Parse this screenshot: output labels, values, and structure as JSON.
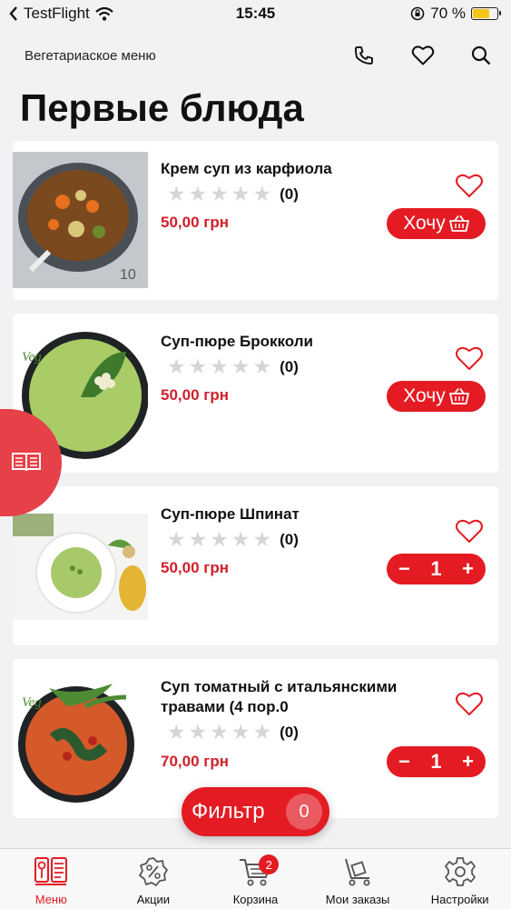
{
  "status": {
    "carrier": "TestFlight",
    "time": "15:45",
    "battery": "70 %",
    "battery_level": 0.7
  },
  "header": {
    "title": "Вегетариаское меню",
    "icons": [
      "phone-icon",
      "heart-icon",
      "search-icon"
    ]
  },
  "page_title": "Первые блюда",
  "products": [
    {
      "name": "Крем суп из карфиола",
      "rating": "(0)",
      "price": "50,00 грн",
      "action": "want",
      "want_label": "Хочу"
    },
    {
      "name": "Суп-пюре Брокколи",
      "rating": "(0)",
      "price": "50,00 грн",
      "action": "want",
      "want_label": "Хочу"
    },
    {
      "name": "Суп-пюре Шпинат",
      "rating": "(0)",
      "price": "50,00 грн",
      "action": "stepper",
      "minus": "−",
      "quantity": "1",
      "plus": "+"
    },
    {
      "name": "Суп томатный с итальянскими травами (4 пор.0",
      "rating": "(0)",
      "price": "70,00 грн",
      "action": "stepper",
      "minus": "−",
      "quantity": "1",
      "plus": "+"
    }
  ],
  "filter": {
    "label": "Фильтр",
    "count": "0"
  },
  "tabbar": {
    "items": [
      {
        "label": "Меню",
        "icon": "menu-book-icon",
        "active": true
      },
      {
        "label": "Акции",
        "icon": "percent-badge-icon"
      },
      {
        "label": "Корзина",
        "icon": "cart-icon",
        "badge": "2"
      },
      {
        "label": "Мои заказы",
        "icon": "trolley-icon"
      },
      {
        "label": "Настройки",
        "icon": "gear-icon"
      }
    ]
  },
  "colors": {
    "accent": "#e41b23",
    "price": "#d11f2a",
    "background": "#f2f2f4",
    "side_tab": "#e64049"
  }
}
